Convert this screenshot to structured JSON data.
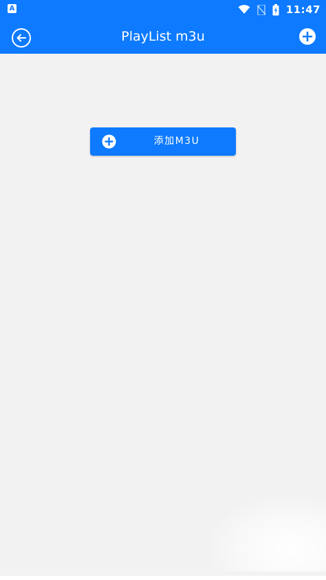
{
  "status_bar": {
    "notification_icon": "A",
    "time": "11:47",
    "icons": [
      "wifi-icon",
      "no-sim-icon",
      "battery-charging-icon"
    ]
  },
  "app_bar": {
    "title": "PlayList m3u",
    "back_icon": "back-arrow-circle-icon",
    "action_icon": "add-circle-icon"
  },
  "main": {
    "add_button": {
      "label": "添加M3U",
      "icon": "add-circle-icon"
    }
  },
  "colors": {
    "primary": "#0d7aff",
    "background": "#f2f2f3",
    "on_primary": "#ffffff"
  }
}
